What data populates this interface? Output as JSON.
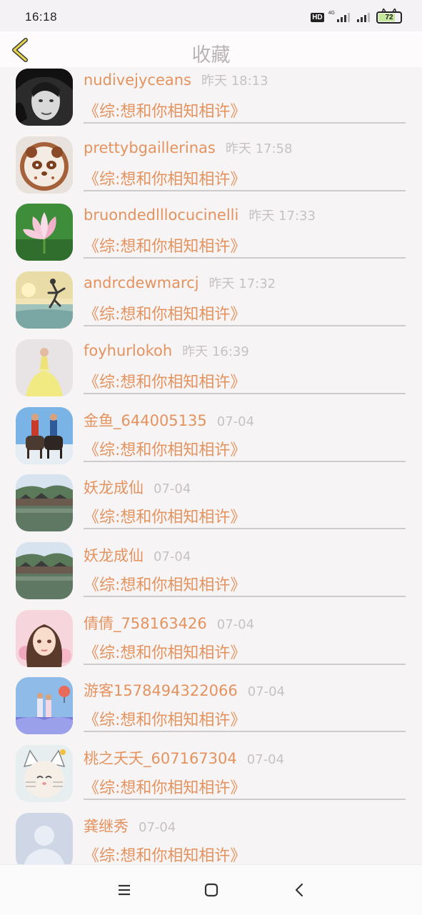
{
  "status_bar": {
    "time": "16:18",
    "hd": "HD",
    "network": "4G",
    "battery": "72"
  },
  "header": {
    "title": "收藏",
    "back_icon": "chevron-left-icon"
  },
  "favorites": [
    {
      "name": "nudivejyceans",
      "time": "昨天 18:13",
      "book": "《综:想和你相知相许》",
      "avatar": "face-portrait"
    },
    {
      "name": "prettybgaillerinas",
      "time": "昨天 17:58",
      "book": "《综:想和你相知相许》",
      "avatar": "panda-latte"
    },
    {
      "name": "bruondedlllocucinelli",
      "time": "昨天 17:33",
      "book": "《综:想和你相知相许》",
      "avatar": "lotus"
    },
    {
      "name": "andrcdewmarcj",
      "time": "昨天 17:32",
      "book": "《综:想和你相知相许》",
      "avatar": "beach-jump"
    },
    {
      "name": "foyhurlokoh",
      "time": "昨天 16:39",
      "book": "《综:想和你相知相许》",
      "avatar": "yellow-dress"
    },
    {
      "name": "金鱼_644005135",
      "time": "07-04",
      "book": "《综:想和你相知相许》",
      "avatar": "horse-riders"
    },
    {
      "name": "妖龙成仙",
      "time": "07-04",
      "book": "《综:想和你相知相许》",
      "avatar": "water-town"
    },
    {
      "name": "妖龙成仙",
      "time": "07-04",
      "book": "《综:想和你相知相许》",
      "avatar": "water-town"
    },
    {
      "name": "倩倩_758163426",
      "time": "07-04",
      "book": "《综:想和你相知相许》",
      "avatar": "anime-girl"
    },
    {
      "name": "游客1578494322066",
      "time": "07-04",
      "book": "《综:想和你相知相许》",
      "avatar": "balloon-couple"
    },
    {
      "name": "桃之夭夭_607167304",
      "time": "07-04",
      "book": "《综:想和你相知相许》",
      "avatar": "cat-baby"
    },
    {
      "name": "龚继秀",
      "time": "07-04",
      "book": "《综:想和你相知相许》",
      "avatar": "default-person"
    }
  ],
  "nav": {
    "menu_icon": "menu-icon",
    "home_icon": "home-square-icon",
    "back_icon": "back-arrow-icon"
  },
  "colors": {
    "accent": "#e4935e",
    "muted": "#c6c2c3",
    "background": "#f7f4f6"
  }
}
